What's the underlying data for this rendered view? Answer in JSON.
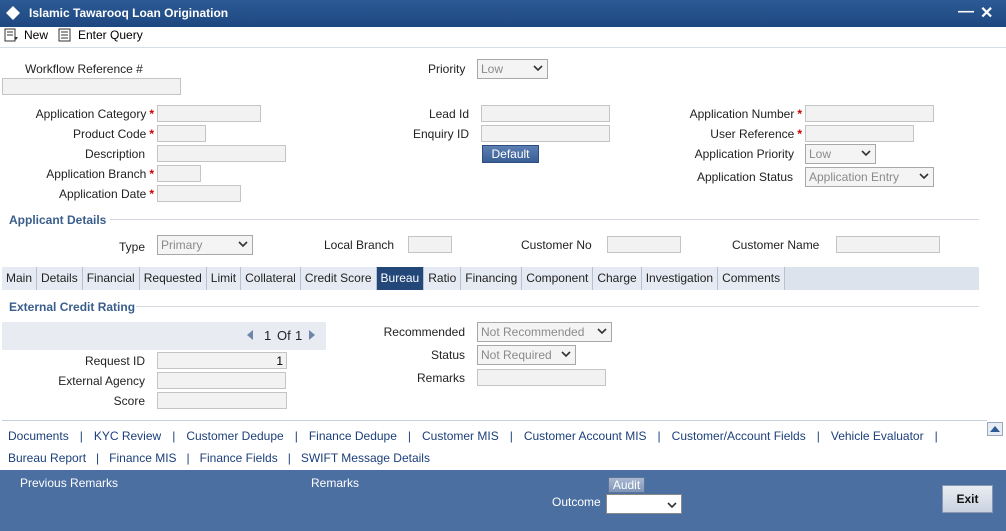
{
  "window": {
    "title": "Islamic Tawarooq Loan Origination"
  },
  "toolbar": {
    "new_label": "New",
    "enter_query_label": "Enter Query"
  },
  "header": {
    "workflow_ref_label": "Workflow Reference #",
    "priority_label": "Priority",
    "priority_value": "Low"
  },
  "app": {
    "category_label": "Application Category",
    "product_code_label": "Product Code",
    "description_label": "Description",
    "branch_label": "Application Branch",
    "date_label": "Application Date",
    "lead_id_label": "Lead Id",
    "enquiry_id_label": "Enquiry ID",
    "default_label": "Default",
    "number_label": "Application Number",
    "user_ref_label": "User Reference",
    "app_priority_label": "Application Priority",
    "app_priority_value": "Low",
    "status_label": "Application Status",
    "status_value": "Application Entry"
  },
  "applicant": {
    "title": "Applicant Details",
    "type_label": "Type",
    "type_value": "Primary",
    "local_branch_label": "Local Branch",
    "customer_no_label": "Customer No",
    "customer_name_label": "Customer Name"
  },
  "tabs": [
    "Main",
    "Details",
    "Financial",
    "Requested",
    "Limit",
    "Collateral",
    "Credit Score",
    "Bureau",
    "Ratio",
    "Financing",
    "Component",
    "Charge",
    "Investigation",
    "Comments"
  ],
  "bureau": {
    "title": "External Credit Rating",
    "pager_current": "1",
    "pager_of": "Of",
    "pager_total": "1",
    "request_id_label": "Request ID",
    "request_id_value": "1",
    "external_agency_label": "External Agency",
    "score_label": "Score",
    "recommended_label": "Recommended",
    "recommended_value": "Not Recommended",
    "status_label": "Status",
    "status_value": "Not Required",
    "remarks_label": "Remarks"
  },
  "links": {
    "row1": [
      "Documents",
      "KYC Review",
      "Customer Dedupe",
      "Finance Dedupe",
      "Customer MIS",
      "Customer Account MIS",
      "Customer/Account Fields",
      "Vehicle Evaluator"
    ],
    "row2": [
      "Bureau Report",
      "Finance MIS",
      "Finance Fields",
      "SWIFT Message Details"
    ],
    "sep": "|"
  },
  "footer": {
    "previous_remarks_label": "Previous Remarks",
    "remarks_label": "Remarks",
    "audit_label": "Audit",
    "outcome_label": "Outcome",
    "exit_label": "Exit"
  }
}
